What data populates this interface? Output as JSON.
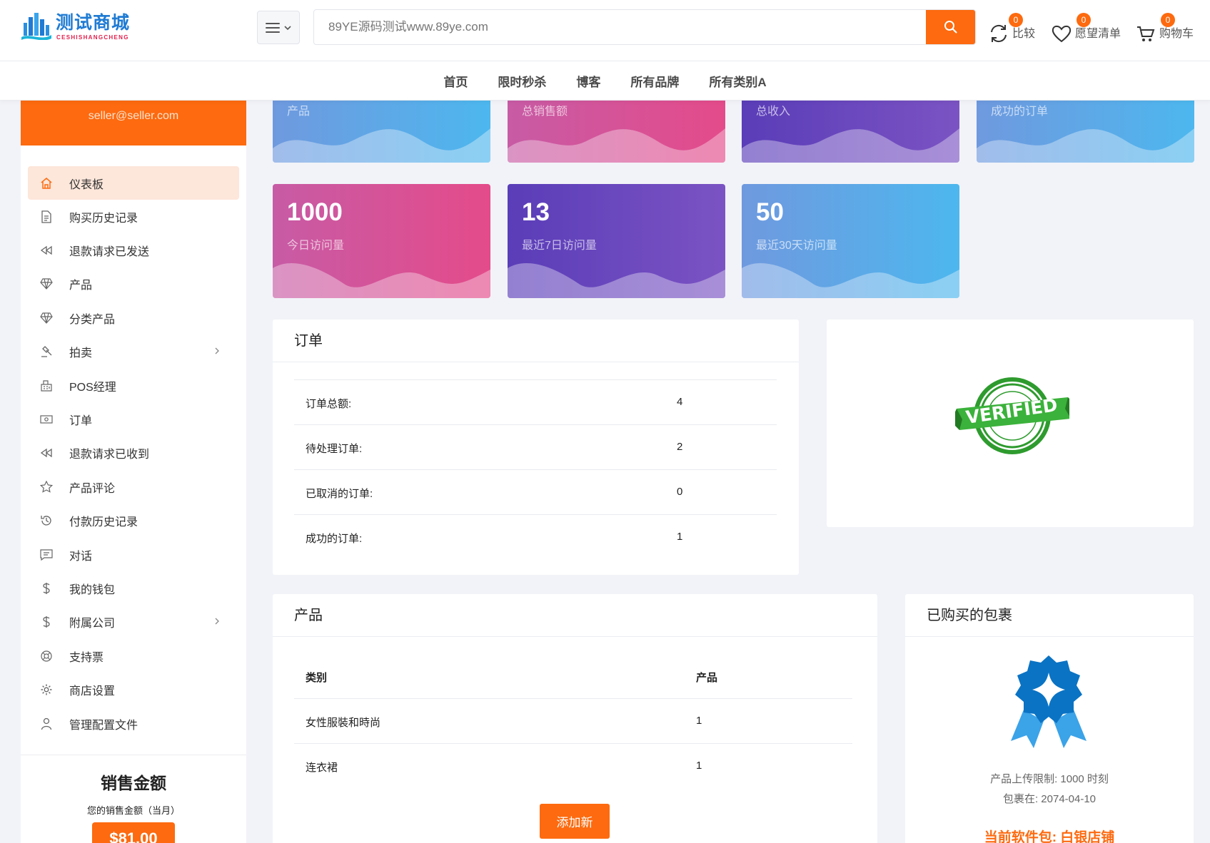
{
  "header": {
    "logo_title": "测试商城",
    "logo_subtitle": "CESHISHANGCHENG",
    "search_placeholder": "89YE源码测试www.89ye.com",
    "compare": {
      "label": "比较",
      "count": "0"
    },
    "wishlist": {
      "label": "愿望清单",
      "count": "0"
    },
    "cart": {
      "label": "购物车",
      "count": "0"
    }
  },
  "nav": [
    "首页",
    "限时秒杀",
    "博客",
    "所有品牌",
    "所有类别A"
  ],
  "sidebar": {
    "email": "seller@seller.com",
    "items": [
      {
        "label": "仪表板",
        "icon": "home-icon",
        "active": true
      },
      {
        "label": "购买历史记录",
        "icon": "document-icon"
      },
      {
        "label": "退款请求已发送",
        "icon": "rewind-icon"
      },
      {
        "label": "产品",
        "icon": "diamond-icon"
      },
      {
        "label": "分类产品",
        "icon": "diamond-icon"
      },
      {
        "label": "拍卖",
        "icon": "gavel-icon",
        "expandable": true
      },
      {
        "label": "POS经理",
        "icon": "cash-register-icon"
      },
      {
        "label": "订单",
        "icon": "money-icon"
      },
      {
        "label": "退款请求已收到",
        "icon": "rewind-icon"
      },
      {
        "label": "产品评论",
        "icon": "star-icon"
      },
      {
        "label": "付款历史记录",
        "icon": "history-icon"
      },
      {
        "label": "对话",
        "icon": "chat-icon"
      },
      {
        "label": "我的钱包",
        "icon": "dollar-icon"
      },
      {
        "label": "附属公司",
        "icon": "dollar-icon",
        "expandable": true
      },
      {
        "label": "支持票",
        "icon": "support-icon"
      },
      {
        "label": "商店设置",
        "icon": "gear-icon"
      },
      {
        "label": "管理配置文件",
        "icon": "user-icon"
      }
    ],
    "sales": {
      "title": "销售金额",
      "subtitle": "您的销售金额（当月）",
      "amount": "$81.00"
    }
  },
  "stats_top": [
    {
      "caption": "产品"
    },
    {
      "caption": "总销售额"
    },
    {
      "caption": "总收入"
    },
    {
      "caption": "成功的订单"
    }
  ],
  "stats": [
    {
      "value": "1000",
      "caption": "今日访问量"
    },
    {
      "value": "13",
      "caption": "最近7日访问量"
    },
    {
      "value": "50",
      "caption": "最近30天访问量"
    }
  ],
  "orders": {
    "title": "订单",
    "rows": [
      {
        "label": "订单总额:",
        "value": "4"
      },
      {
        "label": "待处理订单:",
        "value": "2"
      },
      {
        "label": "已取消的订单:",
        "value": "0"
      },
      {
        "label": "成功的订单:",
        "value": "1"
      }
    ]
  },
  "verified": {
    "badge_text": "VERIFIED"
  },
  "products": {
    "title": "产品",
    "header": {
      "category": "类别",
      "product": "产品"
    },
    "rows": [
      {
        "category": "女性服裝和時尚",
        "product": "1"
      },
      {
        "category": "连衣裙",
        "product": "1"
      }
    ],
    "add_button": "添加新"
  },
  "package": {
    "title": "已购买的包裹",
    "upload_limit": "产品上传限制: 1000 时刻",
    "expires": "包裹在: 2074-04-10",
    "current": "当前软件包: 白银店铺"
  },
  "colors": {
    "accent": "#fd6a0f",
    "logo_blue": "#1f7bd3",
    "logo_red": "#e2204e",
    "verified_green": "#2e9b2e",
    "badge_blue": "#0a73c4"
  }
}
